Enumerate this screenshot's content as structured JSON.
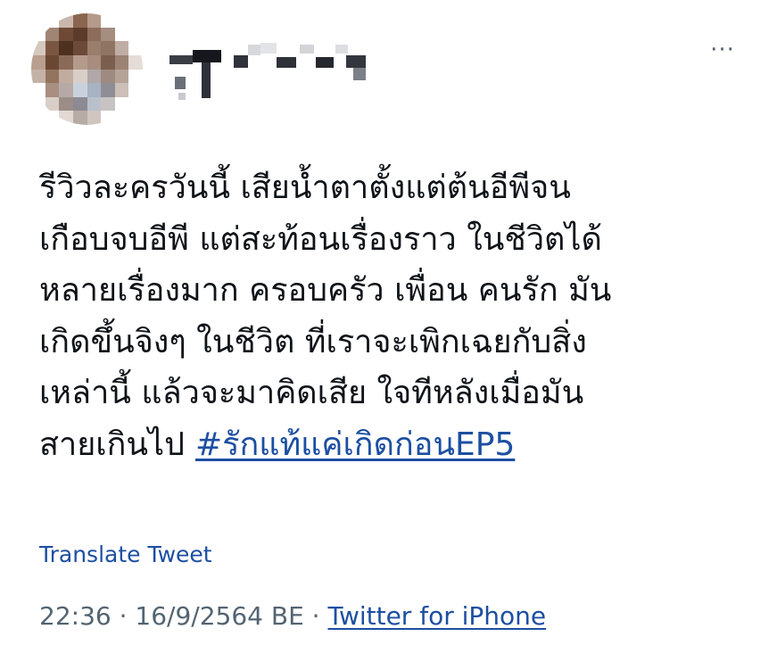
{
  "tweet": {
    "author_avatar_colors": [
      [
        "#ffffff",
        "#ffffff",
        "#c9b7ad",
        "#8a6650",
        "#b59a8a",
        "#ffffff",
        "#ffffff",
        "#ffffff"
      ],
      [
        "#ffffff",
        "#a08575",
        "#6e4a36",
        "#5c3b2a",
        "#8c6d5b",
        "#a58d80",
        "#ffffff",
        "#ffffff"
      ],
      [
        "#d7c8bf",
        "#7a5641",
        "#4e3021",
        "#6b4a39",
        "#9b7d6c",
        "#8f7464",
        "#c0aea4",
        "#ffffff"
      ],
      [
        "#b89f90",
        "#6a4733",
        "#8a6a58",
        "#b49a8b",
        "#a88d7f",
        "#7c5e4e",
        "#9b8374",
        "#e6dcd6"
      ],
      [
        "#c5b2a7",
        "#93745f",
        "#c2aca0",
        "#d9cfc9",
        "#b0a8a8",
        "#9e8a80",
        "#b5a398",
        "#ffffff"
      ],
      [
        "#ffffff",
        "#a88f80",
        "#b7aaa6",
        "#c9d2dc",
        "#a7b3c2",
        "#8f8e96",
        "#cbbfb8",
        "#ffffff"
      ],
      [
        "#ffffff",
        "#dacfc8",
        "#9d8d87",
        "#8c8a92",
        "#b9c0cb",
        "#c8c3c3",
        "#ffffff",
        "#ffffff"
      ],
      [
        "#ffffff",
        "#ffffff",
        "#e2d9d4",
        "#b7aba6",
        "#cfc6c2",
        "#ffffff",
        "#ffffff",
        "#ffffff"
      ]
    ],
    "more_label": "···",
    "text_lines": [
      "รีวิวละครวันนี้ เสียน้ำตาตั้งแต่ต้นอีพีจน",
      "เกือบจบอีพี แต่สะท้อนเรื่องราว ในชีวิตได้",
      "หลายเรื่องมาก ครอบครัว เพื่อน คนรัก มัน",
      "เกิดขึ้นจิงๆ ในชีวิต ที่เราจะเพิกเฉยกับสิ่ง",
      "เหล่านี้ แล้วจะมาคิดเสีย ใจทีหลังเมื่อมัน",
      "สายเกินไป"
    ],
    "hashtag": "#รักแท้แค่เกิดก่อนEP5",
    "translate_label": "Translate Tweet",
    "timestamp": "22:36 · 16/9/2564 BE · ",
    "source": "Twitter for iPhone",
    "colors": {
      "text": "#0f1419",
      "link": "#1d4fa1",
      "secondary": "#536471"
    }
  }
}
